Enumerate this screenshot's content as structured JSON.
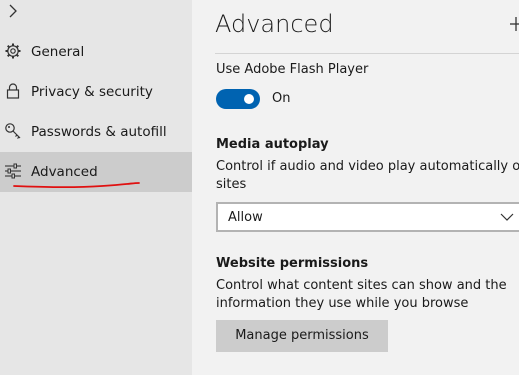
{
  "sidebar": {
    "expand_icon": "chevron-right-icon",
    "items": [
      {
        "label": "General",
        "icon": "gear-icon",
        "selected": false
      },
      {
        "label": "Privacy & security",
        "icon": "lock-icon",
        "selected": false
      },
      {
        "label": "Passwords & autofill",
        "icon": "key-icon",
        "selected": false
      },
      {
        "label": "Advanced",
        "icon": "sliders-icon",
        "selected": true
      }
    ],
    "annotation_color": "#e01010"
  },
  "main": {
    "title": "Advanced",
    "pin_icon": "pin-icon",
    "flash": {
      "label": "Use Adobe Flash Player",
      "toggle_on": true,
      "state_label": "On"
    },
    "media_autoplay": {
      "heading": "Media autoplay",
      "description_line1": "Control if audio and video play automatically on",
      "description_line2": "sites",
      "selected_value": "Allow"
    },
    "website_permissions": {
      "heading": "Website permissions",
      "description_line1": "Control what content sites can show and the",
      "description_line2": "information they use while you browse",
      "button_label": "Manage permissions"
    }
  },
  "colors": {
    "accent": "#0063b1",
    "sidebar_bg": "#e6e6e6",
    "selected_bg": "#cccccc",
    "content_bg": "#f2f2f2"
  }
}
